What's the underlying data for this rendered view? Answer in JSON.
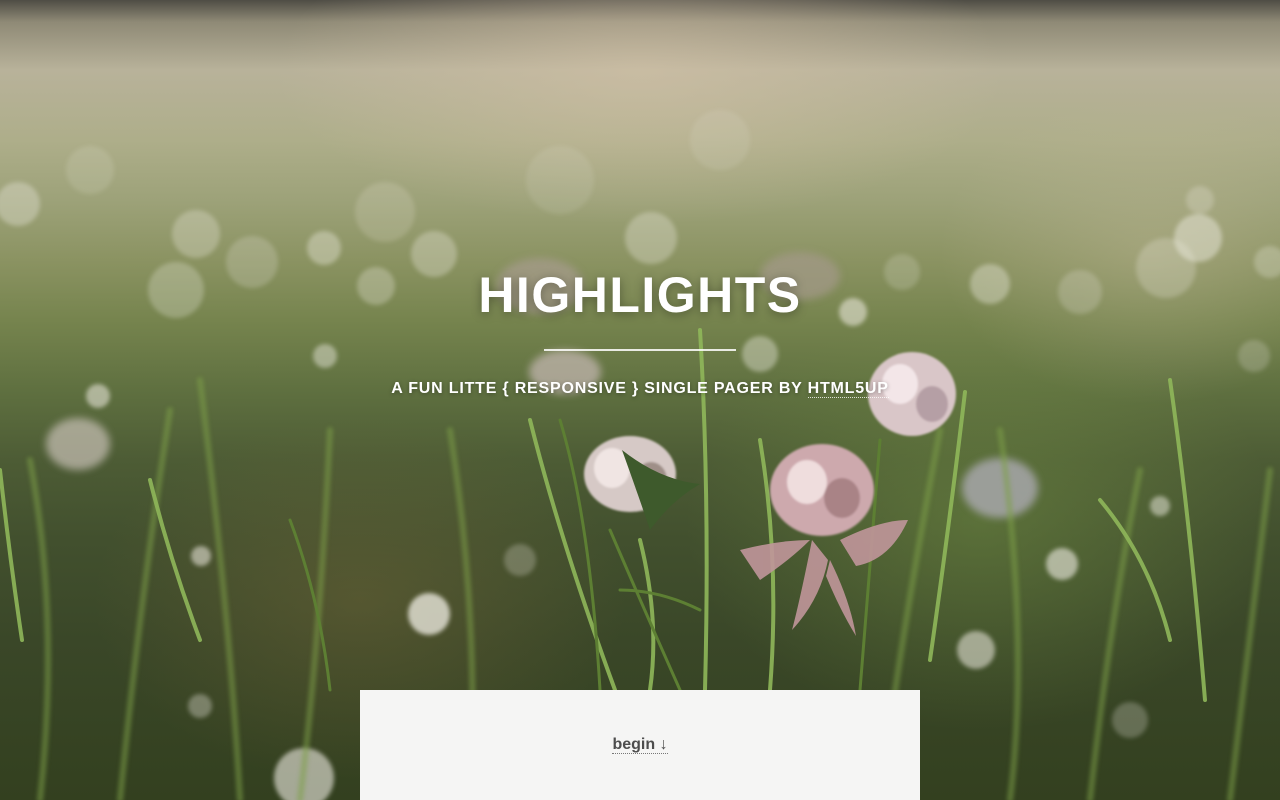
{
  "header": {
    "title": "HIGHLIGHTS",
    "subtitle_prefix": "A FUN LITTE { RESPONSIVE } SINGLE PAGER BY",
    "subtitle_link": "HTML5UP"
  },
  "panel": {
    "begin_label": "begin",
    "begin_icon": "arrow-down-icon",
    "begin_arrow": "↓"
  },
  "colors": {
    "panel_background": "#f5f5f4",
    "heading_text": "#ffffff",
    "link_text": "#4d4d4d"
  },
  "background_image": "grass field with clover blossoms and bokeh"
}
